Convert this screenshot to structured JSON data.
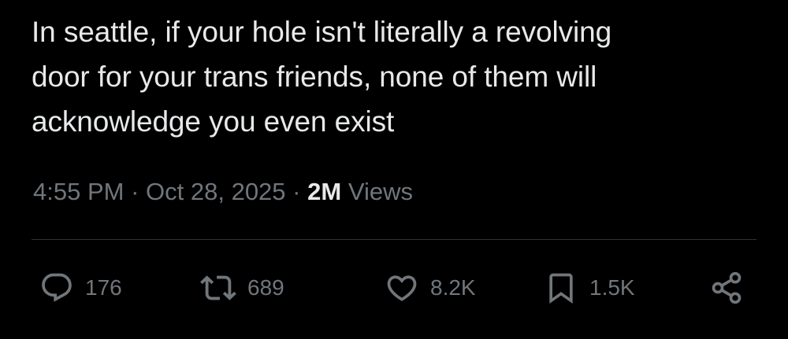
{
  "tweet": {
    "text_lines": [
      "In seattle, if your hole isn't literally a revolving",
      "door for your trans friends, none of them will",
      "acknowledge you even exist"
    ],
    "time": "4:55 PM",
    "separator": "·",
    "date": "Oct 28, 2025",
    "views_count": "2M",
    "views_label": "Views"
  },
  "actions": {
    "reply_count": "176",
    "repost_count": "689",
    "like_count": "8.2K",
    "bookmark_count": "1.5K"
  },
  "icons": {
    "reply": "reply-icon",
    "repost": "repost-icon",
    "like": "heart-icon",
    "bookmark": "bookmark-icon",
    "share": "share-icon"
  },
  "colors": {
    "background": "#000000",
    "text": "#e7e9ea",
    "secondary": "#71767b",
    "divider": "#2f3336"
  }
}
